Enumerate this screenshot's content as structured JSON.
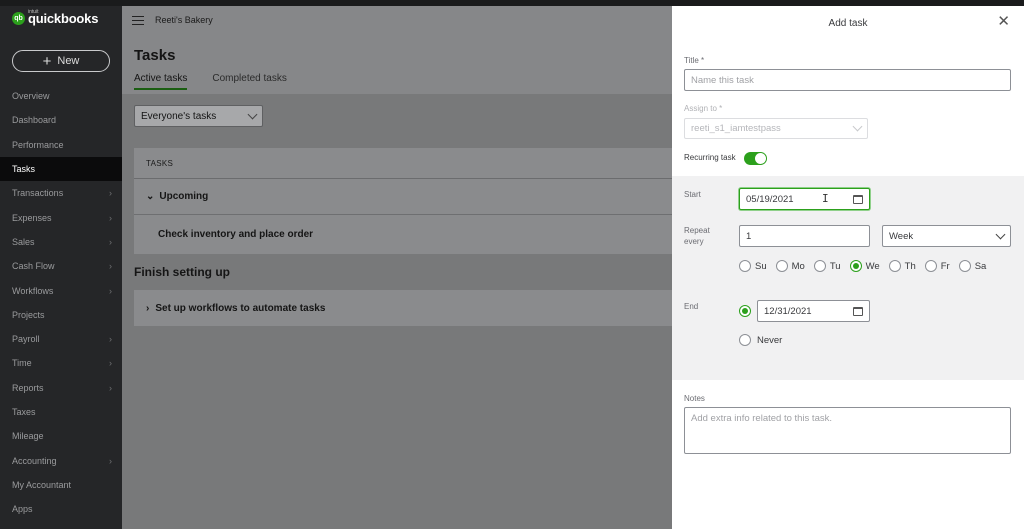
{
  "brand": {
    "small": "intuit",
    "name": "quickbooks",
    "mark": "qb"
  },
  "new_button": {
    "label": "New",
    "icon": "plus-icon"
  },
  "sidebar": {
    "items": [
      {
        "label": "Overview",
        "chevron": false
      },
      {
        "label": "Dashboard",
        "chevron": false
      },
      {
        "label": "Performance",
        "chevron": false
      },
      {
        "label": "Tasks",
        "chevron": false,
        "active": true
      },
      {
        "label": "Transactions",
        "chevron": true
      },
      {
        "label": "Expenses",
        "chevron": true
      },
      {
        "label": "Sales",
        "chevron": true
      },
      {
        "label": "Cash Flow",
        "chevron": true
      },
      {
        "label": "Workflows",
        "chevron": true
      },
      {
        "label": "Projects",
        "chevron": false
      },
      {
        "label": "Payroll",
        "chevron": true
      },
      {
        "label": "Time",
        "chevron": true
      },
      {
        "label": "Reports",
        "chevron": true
      },
      {
        "label": "Taxes",
        "chevron": false
      },
      {
        "label": "Mileage",
        "chevron": false
      },
      {
        "label": "Accounting",
        "chevron": true
      },
      {
        "label": "My Accountant",
        "chevron": false
      },
      {
        "label": "Apps",
        "chevron": false
      }
    ]
  },
  "header": {
    "company": "Reeti's Bakery"
  },
  "main": {
    "title": "Tasks",
    "tabs": [
      {
        "label": "Active tasks",
        "active": true
      },
      {
        "label": "Completed tasks",
        "active": false
      }
    ],
    "filter": "Everyone's tasks",
    "table_header": "TASKS",
    "group": "Upcoming",
    "task": "Check inventory and place order",
    "section_title": "Finish setting up",
    "setup_item": "Set up workflows to automate tasks"
  },
  "panel": {
    "title": "Add task",
    "title_label": "Title *",
    "title_placeholder": "Name this task",
    "assign_label": "Assign to *",
    "assign_value": "reeti_s1_iamtestpass",
    "recurring_label": "Recurring task",
    "recurring_on": true,
    "start_label": "Start",
    "start_date": "05/19/2021",
    "repeat_label_1": "Repeat",
    "repeat_label_2": "every",
    "repeat_value": "1",
    "repeat_unit": "Week",
    "days": [
      {
        "label": "Su",
        "checked": false
      },
      {
        "label": "Mo",
        "checked": false
      },
      {
        "label": "Tu",
        "checked": false
      },
      {
        "label": "We",
        "checked": true
      },
      {
        "label": "Th",
        "checked": false
      },
      {
        "label": "Fr",
        "checked": false
      },
      {
        "label": "Sa",
        "checked": false
      }
    ],
    "end_label": "End",
    "end_date": "12/31/2021",
    "never_label": "Never",
    "notes_label": "Notes",
    "notes_placeholder": "Add extra info related to this task."
  },
  "colors": {
    "accent": "#2ca01c",
    "sidebar": "#252628"
  }
}
